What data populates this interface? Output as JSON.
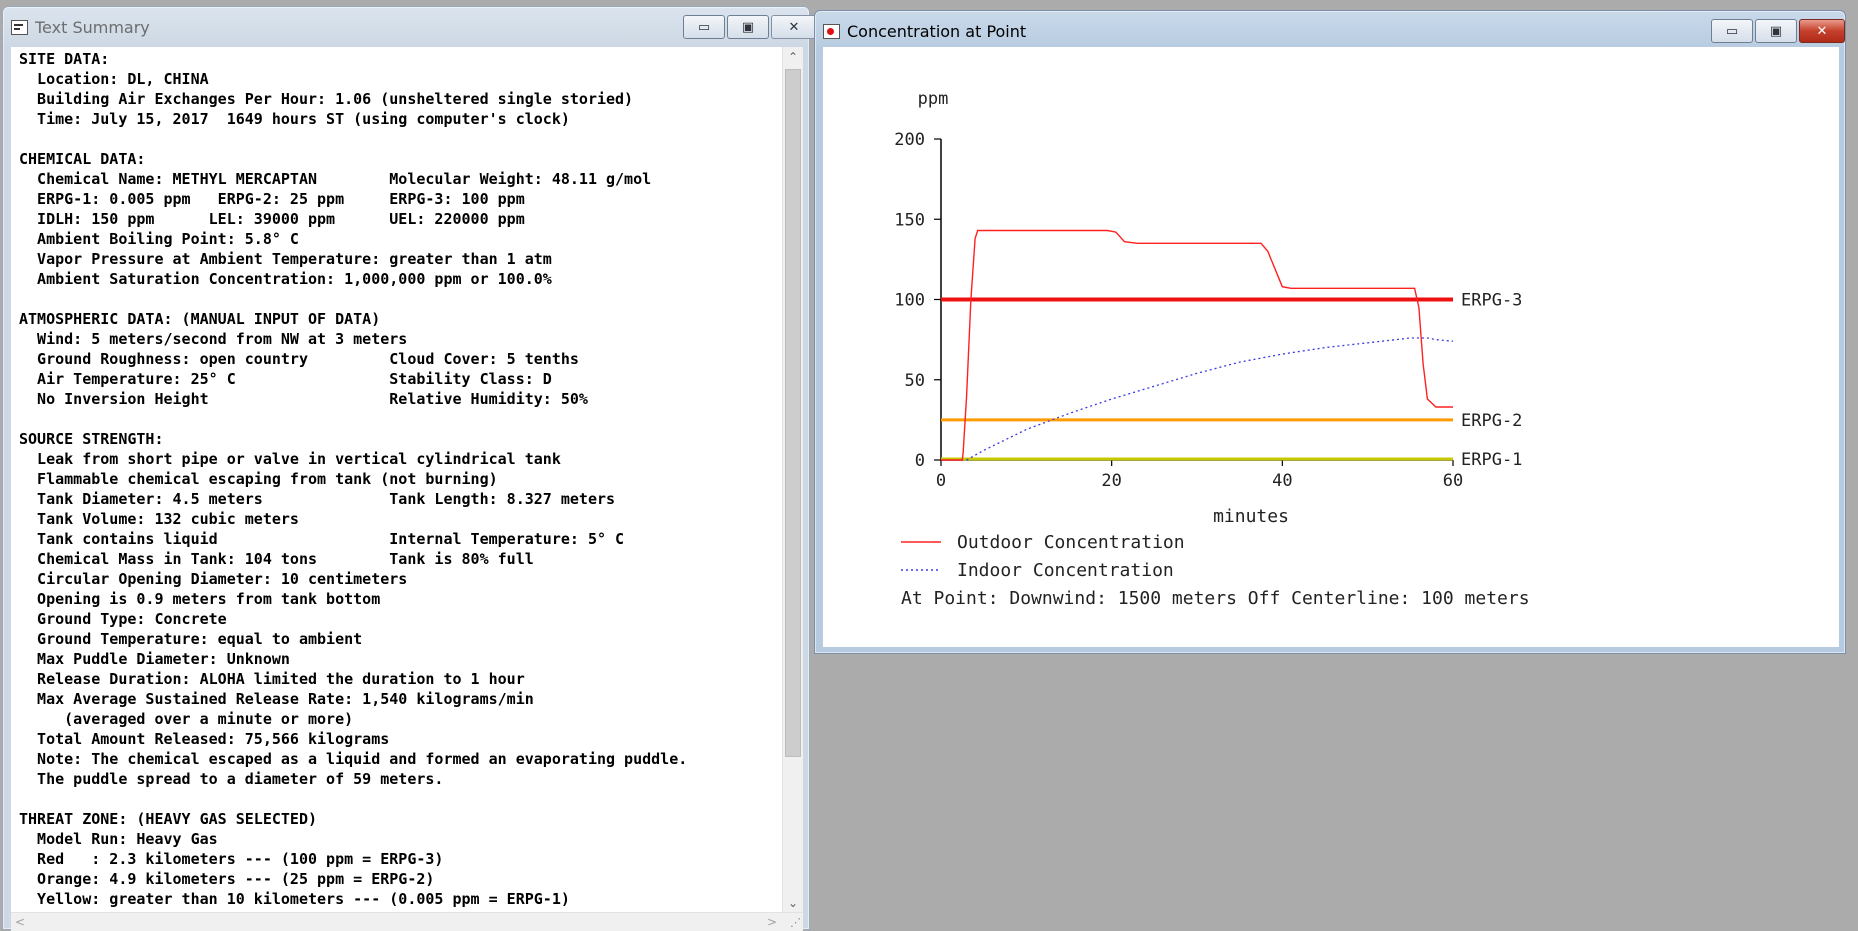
{
  "summary_window": {
    "title": "Text Summary",
    "controls": {
      "minimize": "▭",
      "maximize": "▣",
      "close": "✕"
    },
    "lines": [
      "SITE DATA:",
      "  Location: DL, CHINA",
      "  Building Air Exchanges Per Hour: 1.06 (unsheltered single storied)",
      "  Time: July 15, 2017  1649 hours ST (using computer's clock)",
      "",
      "CHEMICAL DATA:",
      "  Chemical Name: METHYL MERCAPTAN        Molecular Weight: 48.11 g/mol",
      "  ERPG-1: 0.005 ppm   ERPG-2: 25 ppm     ERPG-3: 100 ppm",
      "  IDLH: 150 ppm      LEL: 39000 ppm      UEL: 220000 ppm",
      "  Ambient Boiling Point: 5.8° C",
      "  Vapor Pressure at Ambient Temperature: greater than 1 atm",
      "  Ambient Saturation Concentration: 1,000,000 ppm or 100.0%",
      "",
      "ATMOSPHERIC DATA: (MANUAL INPUT OF DATA)",
      "  Wind: 5 meters/second from NW at 3 meters",
      "  Ground Roughness: open country         Cloud Cover: 5 tenths",
      "  Air Temperature: 25° C                 Stability Class: D",
      "  No Inversion Height                    Relative Humidity: 50%",
      "",
      "SOURCE STRENGTH:",
      "  Leak from short pipe or valve in vertical cylindrical tank",
      "  Flammable chemical escaping from tank (not burning)",
      "  Tank Diameter: 4.5 meters              Tank Length: 8.327 meters",
      "  Tank Volume: 132 cubic meters",
      "  Tank contains liquid                   Internal Temperature: 5° C",
      "  Chemical Mass in Tank: 104 tons        Tank is 80% full",
      "  Circular Opening Diameter: 10 centimeters",
      "  Opening is 0.9 meters from tank bottom",
      "  Ground Type: Concrete",
      "  Ground Temperature: equal to ambient",
      "  Max Puddle Diameter: Unknown",
      "  Release Duration: ALOHA limited the duration to 1 hour",
      "  Max Average Sustained Release Rate: 1,540 kilograms/min",
      "     (averaged over a minute or more)",
      "  Total Amount Released: 75,566 kilograms",
      "  Note: The chemical escaped as a liquid and formed an evaporating puddle.",
      "  The puddle spread to a diameter of 59 meters.",
      "",
      "THREAT ZONE: (HEAVY GAS SELECTED)",
      "  Model Run: Heavy Gas",
      "  Red   : 2.3 kilometers --- (100 ppm = ERPG-3)",
      "  Orange: 4.9 kilometers --- (25 ppm = ERPG-2)",
      "  Yellow: greater than 10 kilometers --- (0.005 ppm = ERPG-1)"
    ],
    "scroll": {
      "up": "⌃",
      "down": "⌄",
      "left": "<",
      "right": ">",
      "grip": "⋰"
    }
  },
  "chart_window": {
    "title": "Concentration at Point",
    "controls": {
      "minimize": "▭",
      "maximize": "▣",
      "close": "✕"
    },
    "legend": {
      "outdoor": "Outdoor Concentration",
      "indoor": "Indoor Concentration"
    },
    "point_info": "At Point:   Downwind: 1500 meters   Off Centerline: 100 meters"
  },
  "colors": {
    "outdoor": "#ff2020",
    "indoor": "#3a3ae0",
    "erpg3": "#ee1111",
    "erpg2": "#ff9a00",
    "erpg1": "#c8c800",
    "axis": "#000000"
  },
  "chart_data": {
    "type": "line",
    "ylabel": "ppm",
    "xlabel": "minutes",
    "xlim": [
      0,
      60
    ],
    "ylim": [
      0,
      200
    ],
    "xticks": [
      0,
      20,
      40,
      60
    ],
    "yticks": [
      0,
      50,
      100,
      150,
      200
    ],
    "grid": false,
    "series": [
      {
        "name": "Outdoor Concentration",
        "style": "solid",
        "x": [
          0,
          2.5,
          2.6,
          3.0,
          3.5,
          4.0,
          4.3,
          19.5,
          20.5,
          21.5,
          23,
          37.5,
          38.3,
          40.0,
          41,
          55.5,
          56.0,
          56.5,
          57,
          58,
          60
        ],
        "y": [
          0,
          0,
          5,
          40,
          100,
          138,
          143,
          143,
          142,
          136,
          135,
          135,
          130,
          108,
          107,
          107,
          95,
          60,
          38,
          33,
          33
        ]
      },
      {
        "name": "Indoor Concentration",
        "style": "dotted",
        "x": [
          3,
          5,
          10,
          15,
          20,
          25,
          30,
          35,
          40,
          45,
          50,
          55,
          56,
          57,
          58,
          60
        ],
        "y": [
          0,
          6,
          19,
          29,
          38,
          46,
          54,
          61,
          66,
          70,
          73,
          76,
          76,
          76,
          75,
          74
        ]
      }
    ],
    "threshold_lines": [
      {
        "label": "ERPG-3",
        "y": 100
      },
      {
        "label": "ERPG-2",
        "y": 25
      },
      {
        "label": "ERPG-1",
        "y": 0.005
      }
    ]
  }
}
